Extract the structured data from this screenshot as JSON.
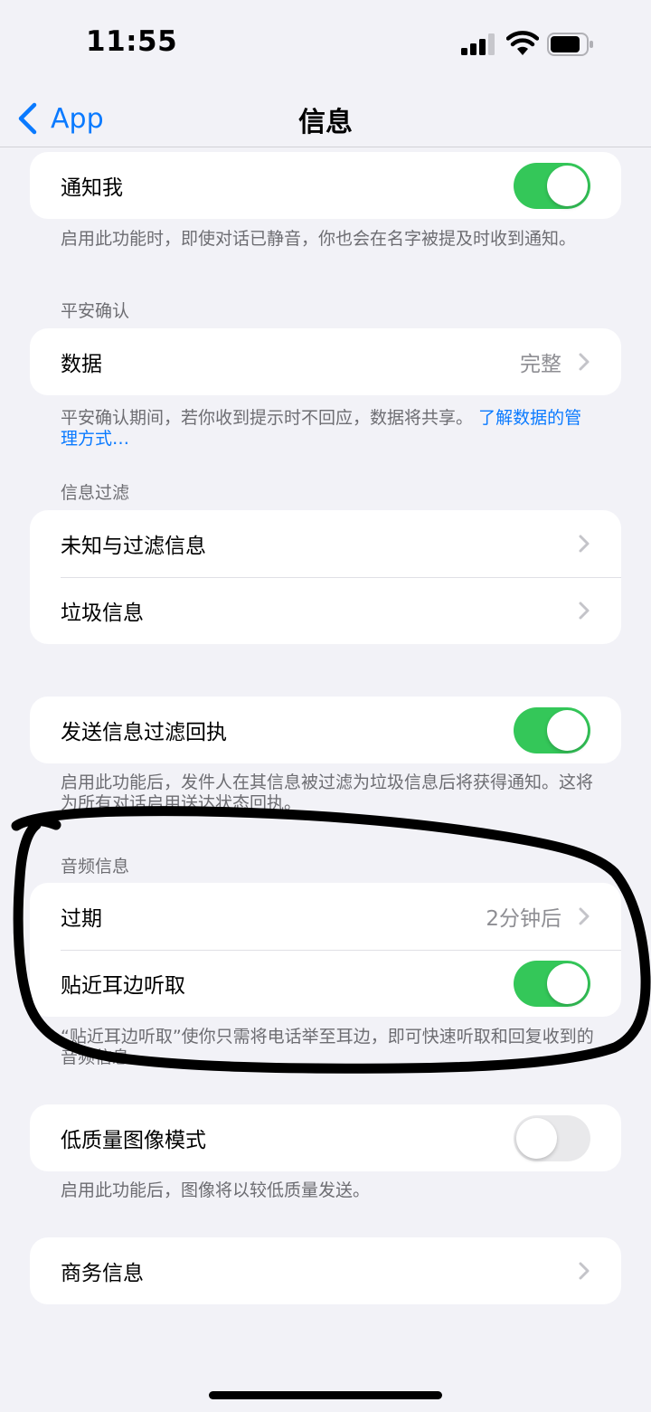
{
  "status_bar": {
    "time": "11:55"
  },
  "nav": {
    "back_label": "App",
    "title": "信息"
  },
  "notify_group": {
    "label": "通知我",
    "toggle_on": true,
    "footer": "启用此功能时，即使对话已静音，你也会在名字被提及时收到通知。"
  },
  "safety_group": {
    "header": "平安确认",
    "row_label": "数据",
    "row_value": "完整",
    "footer_text": "平安确认期间，若你收到提示时不回应，数据将共享。",
    "footer_link": "了解数据的管理方式…"
  },
  "filter_group": {
    "header": "信息过滤",
    "items": [
      {
        "label": "未知与过滤信息"
      },
      {
        "label": "垃圾信息"
      }
    ]
  },
  "receipt_group": {
    "label": "发送信息过滤回执",
    "toggle_on": true,
    "footer": "启用此功能后，发件人在其信息被过滤为垃圾信息后将获得通知。这将为所有对话启用送达状态回执。"
  },
  "audio_group": {
    "header": "音频信息",
    "expire_label": "过期",
    "expire_value": "2分钟后",
    "raise_label": "贴近耳边听取",
    "raise_toggle_on": true,
    "footer": "“贴近耳边听取”使你只需将电话举至耳边，即可快速听取和回复收到的音频信息。"
  },
  "low_quality_group": {
    "label": "低质量图像模式",
    "toggle_on": false,
    "footer": "启用此功能后，图像将以较低质量发送。"
  },
  "business_group": {
    "label": "商务信息"
  },
  "colors": {
    "accent": "#0a7aff",
    "toggle_on": "#34c759",
    "toggle_off": "#e9e9eb",
    "background": "#f2f2f7",
    "secondary_text": "#6d6d72",
    "annotation_ink": "#000000"
  },
  "icons": [
    "signal-icon",
    "wifi-icon",
    "battery-icon",
    "back-chevron-icon",
    "chevron-right-icon"
  ]
}
